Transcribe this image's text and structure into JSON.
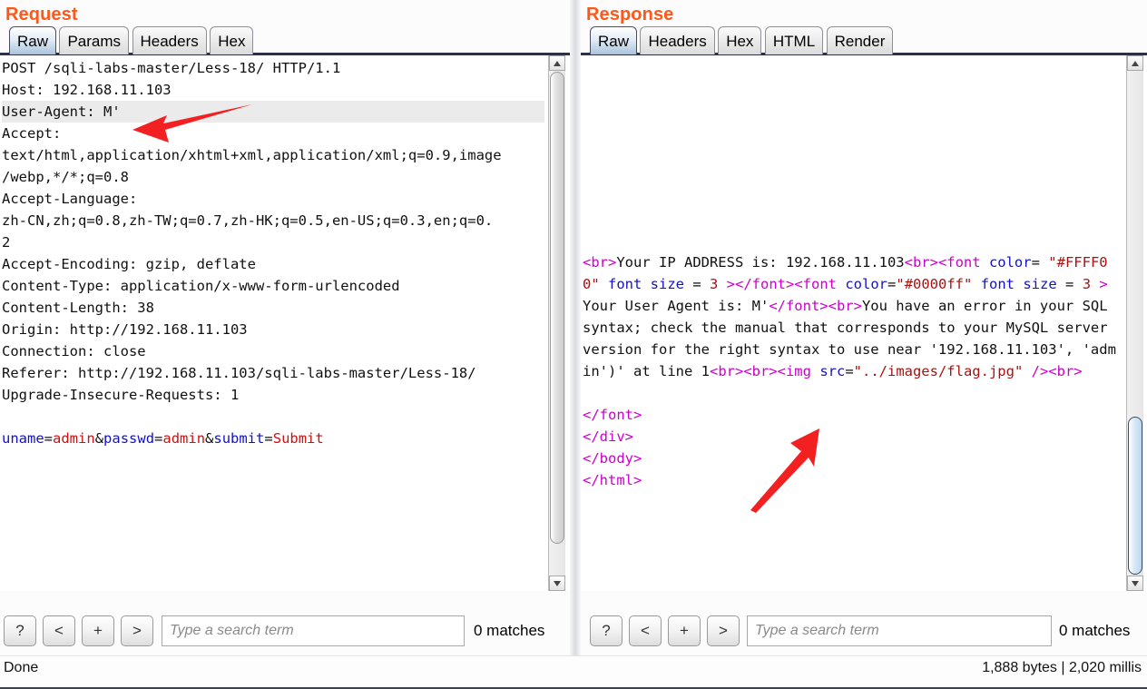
{
  "request": {
    "title": "Request",
    "tabs": [
      {
        "label": "Raw",
        "active": true
      },
      {
        "label": "Params",
        "active": false
      },
      {
        "label": "Headers",
        "active": false
      },
      {
        "label": "Hex",
        "active": false
      }
    ],
    "lines": [
      "POST /sqli-labs-master/Less-18/ HTTP/1.1",
      "Host: 192.168.11.103",
      "User-Agent: M'",
      "Accept:",
      "text/html,application/xhtml+xml,application/xml;q=0.9,image",
      "/webp,*/*;q=0.8",
      "Accept-Language:",
      "zh-CN,zh;q=0.8,zh-TW;q=0.7,zh-HK;q=0.5,en-US;q=0.3,en;q=0.",
      "2",
      "Accept-Encoding: gzip, deflate",
      "Content-Type: application/x-www-form-urlencoded",
      "Content-Length: 38",
      "Origin: http://192.168.11.103",
      "Connection: close",
      "Referer: http://192.168.11.103/sqli-labs-master/Less-18/",
      "Upgrade-Insecure-Requests: 1"
    ],
    "highlighted_line_index": 2,
    "body_params": [
      {
        "name": "uname",
        "sep": "=",
        "value": "admin"
      },
      {
        "name": "passwd",
        "sep": "=",
        "value": "admin",
        "prefix": "&"
      },
      {
        "name": "submit",
        "sep": "=",
        "value": "Submit",
        "prefix": "&"
      }
    ],
    "search": {
      "help_label": "?",
      "prev_label": "<",
      "add_label": "+",
      "next_label": ">",
      "placeholder": "Type a search term",
      "value": "",
      "matches": "0 matches"
    }
  },
  "response": {
    "title": "Response",
    "tabs": [
      {
        "label": "Raw",
        "active": true
      },
      {
        "label": "Headers",
        "active": false
      },
      {
        "label": "Hex",
        "active": false
      },
      {
        "label": "HTML",
        "active": false
      },
      {
        "label": "Render",
        "active": false
      }
    ],
    "tokens": [
      {
        "t": "tag",
        "s": "<br>"
      },
      {
        "t": "plain",
        "s": "Your IP ADDRESS is: 192.168.11.103"
      },
      {
        "t": "tag",
        "s": "<br>"
      },
      {
        "t": "tag",
        "s": "<font "
      },
      {
        "t": "attr",
        "s": "color"
      },
      {
        "t": "plain",
        "s": "= "
      },
      {
        "t": "val",
        "s": "\"#FFFF00\""
      },
      {
        "t": "attr",
        "s": " font size "
      },
      {
        "t": "plain",
        "s": "= "
      },
      {
        "t": "val",
        "s": "3"
      },
      {
        "t": "tag",
        "s": " >"
      },
      {
        "t": "tag",
        "s": "</font>"
      },
      {
        "t": "tag",
        "s": "<font "
      },
      {
        "t": "attr",
        "s": "color"
      },
      {
        "t": "plain",
        "s": "="
      },
      {
        "t": "val",
        "s": "\"#0000ff\""
      },
      {
        "t": "attr",
        "s": " font size "
      },
      {
        "t": "plain",
        "s": "= "
      },
      {
        "t": "val",
        "s": "3"
      },
      {
        "t": "tag",
        "s": " >"
      },
      {
        "t": "plain",
        "s": "Your User Agent is: M'"
      },
      {
        "t": "tag",
        "s": "</font>"
      },
      {
        "t": "tag",
        "s": "<br>"
      },
      {
        "t": "plain",
        "s": "You have an error in your SQL syntax; check the manual that corresponds to your MySQL server version for the right syntax to use near '192.168.11.103', 'admin')' at line 1"
      },
      {
        "t": "tag",
        "s": "<br>"
      },
      {
        "t": "tag",
        "s": "<br>"
      },
      {
        "t": "tag",
        "s": "<img "
      },
      {
        "t": "attr",
        "s": "src"
      },
      {
        "t": "plain",
        "s": "="
      },
      {
        "t": "val",
        "s": "\"../images/flag.jpg\""
      },
      {
        "t": "tag",
        "s": " />"
      },
      {
        "t": "tag",
        "s": "<br>"
      },
      {
        "t": "plain",
        "s": "\n\n"
      },
      {
        "t": "tag",
        "s": "</font>"
      },
      {
        "t": "plain",
        "s": "\n"
      },
      {
        "t": "tag",
        "s": "</div>"
      },
      {
        "t": "plain",
        "s": "\n"
      },
      {
        "t": "tag",
        "s": "</body>"
      },
      {
        "t": "plain",
        "s": "\n"
      },
      {
        "t": "tag",
        "s": "</html>"
      }
    ],
    "search": {
      "help_label": "?",
      "prev_label": "<",
      "add_label": "+",
      "next_label": ">",
      "placeholder": "Type a search term",
      "value": "",
      "matches": "0 matches"
    }
  },
  "status": {
    "left": "Done",
    "right": "1,888 bytes | 2,020 millis"
  },
  "annotations": {
    "arrow_color": "#f22020",
    "arrow_request_target": "User-Agent: M'",
    "arrow_response_target": "\"../images/flag.jpg\""
  },
  "colors": {
    "panel_title": "#ff5719",
    "tag": "#cc00cc",
    "attribute": "#1111cc",
    "value": "#aa1111",
    "active_tab": "#a9c3dd",
    "tab_underline": "#2b3044"
  }
}
